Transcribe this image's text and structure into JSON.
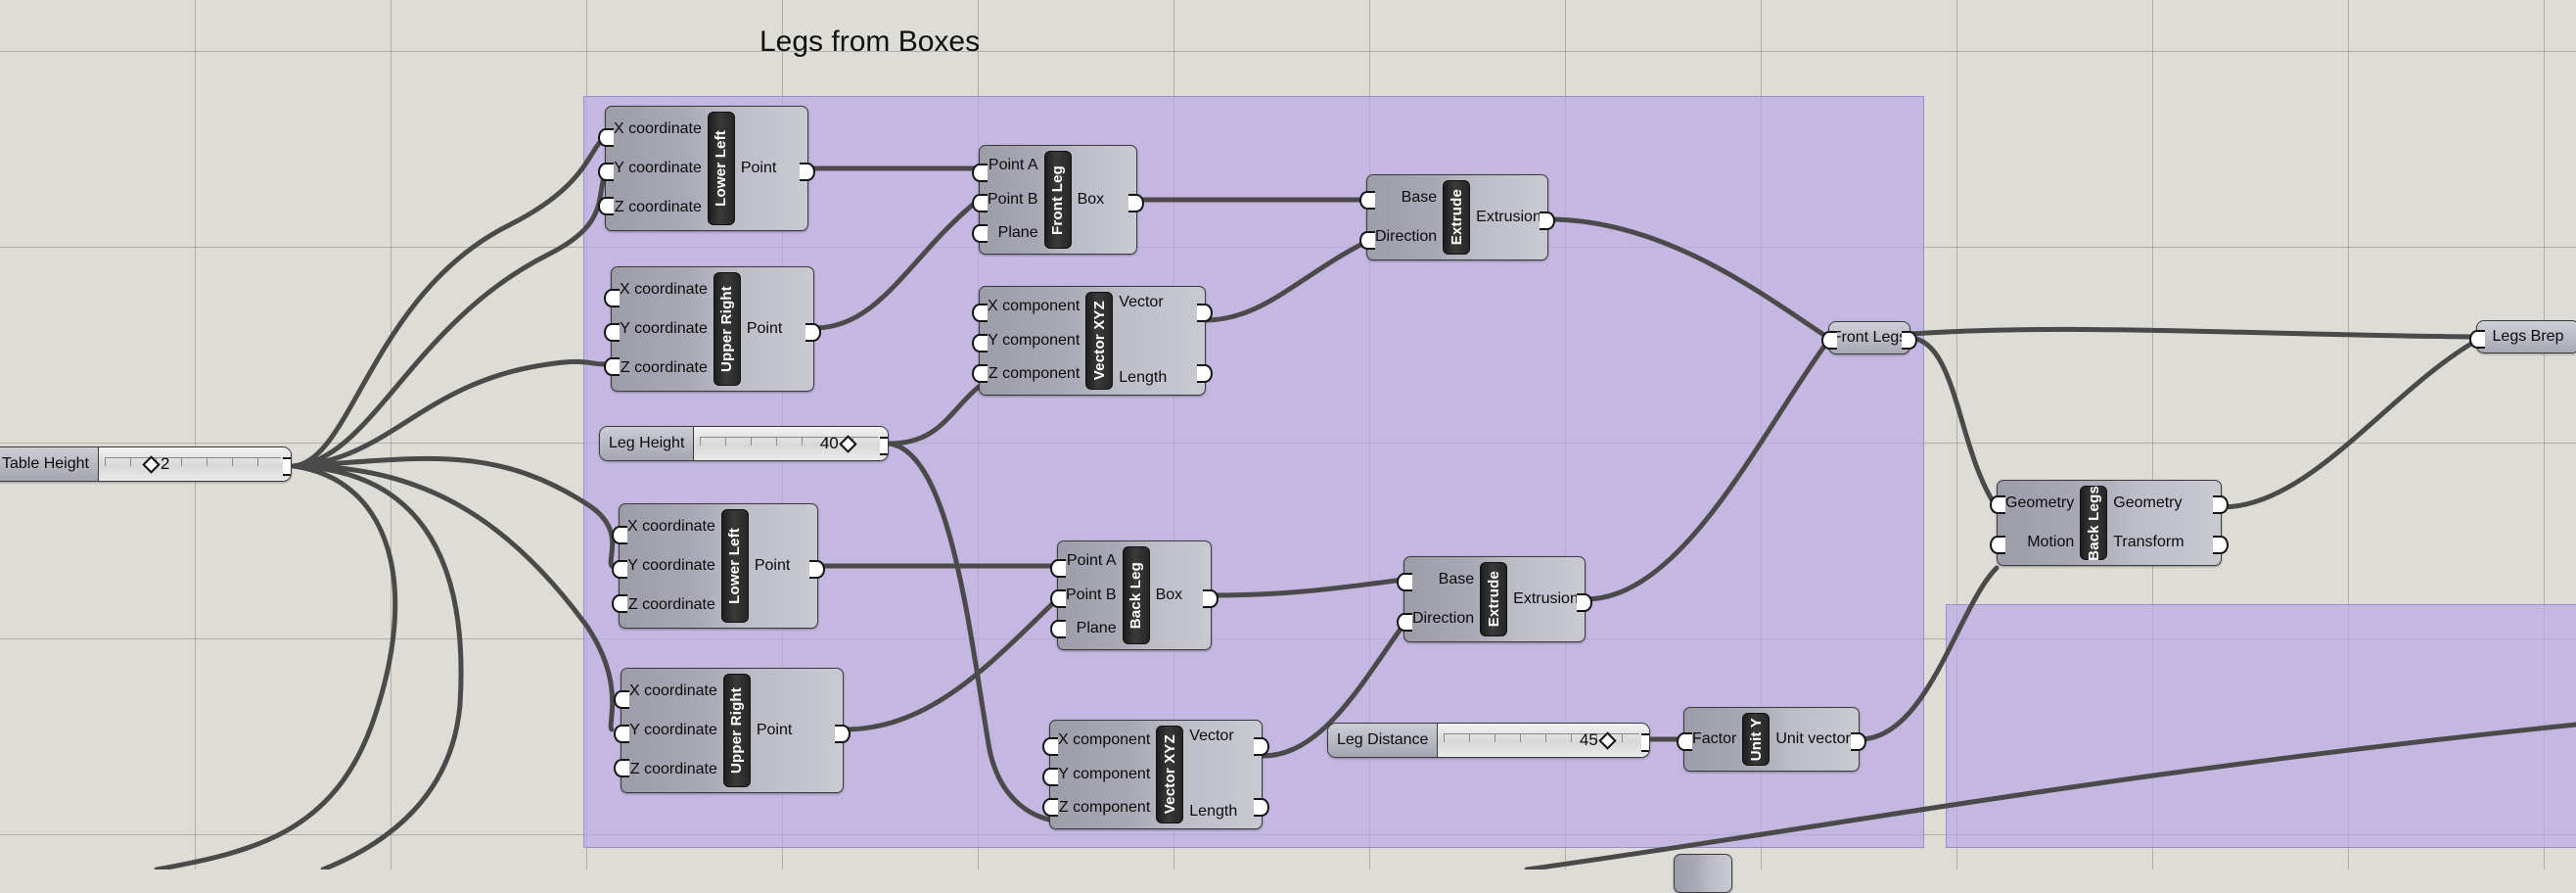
{
  "canvas": {
    "title": "Legs from Boxes",
    "background_color": "#dedcd6",
    "grid_color": "#8c8a84",
    "group_color": "#baabe7"
  },
  "sliders": [
    {
      "name": "Table Height",
      "value": "2",
      "handle_pct": 18
    },
    {
      "name": "Leg Height",
      "value": "40",
      "handle_pct": 76
    },
    {
      "name": "Leg Distance",
      "value": "45",
      "handle_pct": 79
    }
  ],
  "params": [
    {
      "name": "Front Legs"
    },
    {
      "name": "Legs Brep"
    }
  ],
  "components": [
    {
      "name": "Lower Left",
      "inputs": [
        "X coordinate",
        "Y coordinate",
        "Z coordinate"
      ],
      "outputs": [
        "Point"
      ]
    },
    {
      "name": "Upper Right",
      "inputs": [
        "X coordinate",
        "Y coordinate",
        "Z coordinate"
      ],
      "outputs": [
        "Point"
      ]
    },
    {
      "name": "Front Leg",
      "inputs": [
        "Point A",
        "Point B",
        "Plane"
      ],
      "outputs": [
        "Box"
      ]
    },
    {
      "name": "Extrude",
      "inputs": [
        "Base",
        "Direction"
      ],
      "outputs": [
        "Extrusion"
      ]
    },
    {
      "name": "Vector XYZ",
      "inputs": [
        "X component",
        "Y component",
        "Z component"
      ],
      "outputs": [
        "Vector",
        "Length"
      ]
    },
    {
      "name": "Lower Left",
      "inputs": [
        "X coordinate",
        "Y coordinate",
        "Z coordinate"
      ],
      "outputs": [
        "Point"
      ]
    },
    {
      "name": "Upper Right",
      "inputs": [
        "X coordinate",
        "Y coordinate",
        "Z coordinate"
      ],
      "outputs": [
        "Point"
      ]
    },
    {
      "name": "Back Leg",
      "inputs": [
        "Point A",
        "Point B",
        "Plane"
      ],
      "outputs": [
        "Box"
      ]
    },
    {
      "name": "Extrude",
      "inputs": [
        "Base",
        "Direction"
      ],
      "outputs": [
        "Extrusion"
      ]
    },
    {
      "name": "Vector XYZ",
      "inputs": [
        "X component",
        "Y component",
        "Z component"
      ],
      "outputs": [
        "Vector",
        "Length"
      ]
    },
    {
      "name": "Unit Y",
      "inputs": [
        "Factor"
      ],
      "outputs": [
        "Unit vector"
      ]
    },
    {
      "name": "Back Legs",
      "inputs": [
        "Geometry",
        "Motion"
      ],
      "outputs": [
        "Geometry",
        "Transform"
      ]
    }
  ]
}
